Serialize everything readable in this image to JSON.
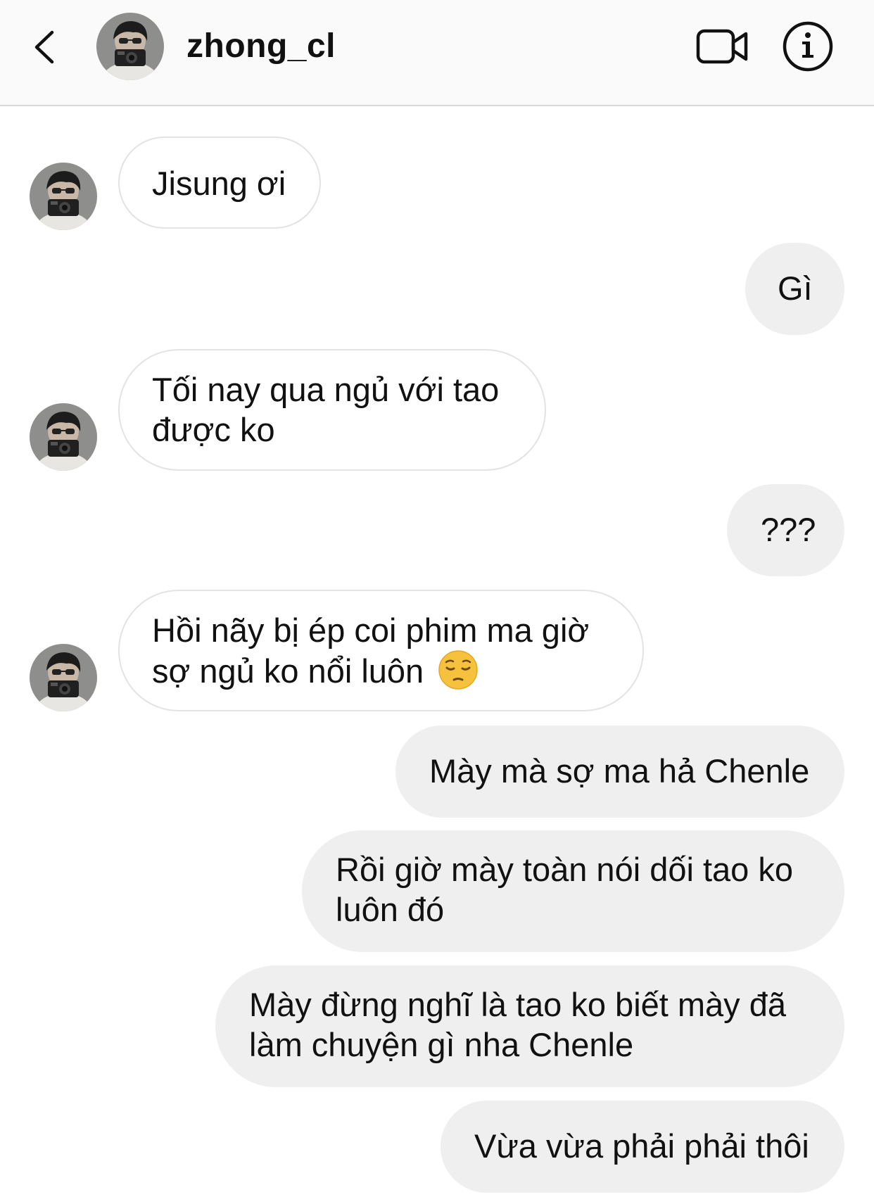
{
  "header": {
    "username": "zhong_cl",
    "icons": {
      "back": "chevron-left-icon",
      "video": "video-camera-icon",
      "info": "info-icon"
    }
  },
  "messages": [
    {
      "from": "them",
      "text": "Jisung ơi"
    },
    {
      "from": "me",
      "text": "Gì"
    },
    {
      "from": "them",
      "lines": [
        "Tối nay qua ngủ với tao",
        "được ko"
      ]
    },
    {
      "from": "me",
      "text": "???"
    },
    {
      "from": "them",
      "lines": [
        "Hồi nãy bị ép coi phim ma giờ",
        "sợ ngủ ko nổi luôn"
      ],
      "emoji": "pensive-face-emoji"
    },
    {
      "from": "me",
      "text": "Mày mà sợ ma hả Chenle"
    },
    {
      "from": "me",
      "lines": [
        "Rồi giờ mày toàn nói dối tao ko",
        "luôn đó"
      ]
    },
    {
      "from": "me",
      "lines": [
        "Mày đừng nghĩ là tao ko biết mày đã",
        "làm chuyện gì nha Chenle"
      ]
    },
    {
      "from": "me",
      "text": "Vừa vừa phải phải thôi"
    }
  ],
  "colors": {
    "incoming_bubble": "#ffffff",
    "incoming_border": "#e3e3e3",
    "outgoing_bubble": "#efefef",
    "header_bg": "#fafafa"
  }
}
